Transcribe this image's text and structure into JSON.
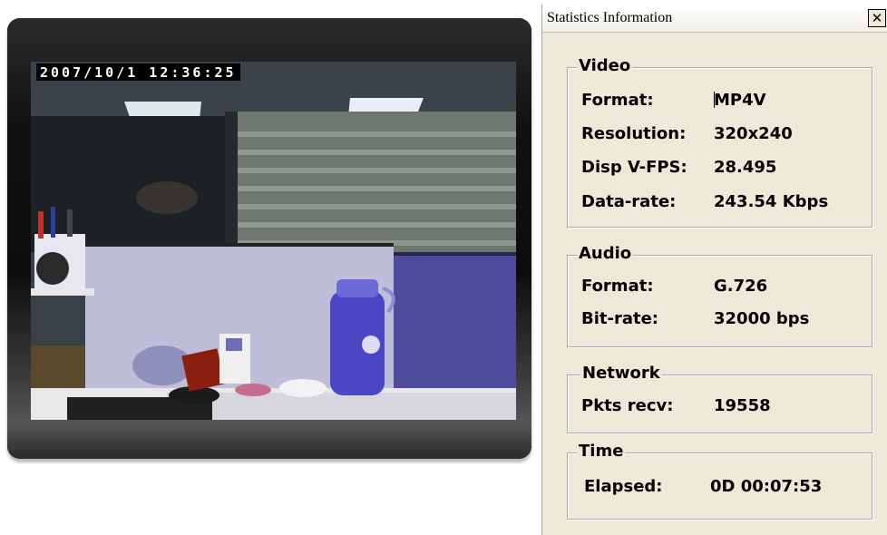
{
  "viewer": {
    "timestamp": "2007/10/1  12:36:25"
  },
  "dialog": {
    "title": "Statistics Information",
    "close_glyph": "✕",
    "video": {
      "legend": "Video",
      "format_label": "Format:",
      "format_value": "MP4V",
      "resolution_label": "Resolution:",
      "resolution_value": "320x240",
      "fps_label": "Disp V-FPS:",
      "fps_value": "28.495",
      "datarate_label": "Data-rate:",
      "datarate_value": "243.54  Kbps"
    },
    "audio": {
      "legend": "Audio",
      "format_label": "Format:",
      "format_value": "G.726",
      "bitrate_label": "Bit-rate:",
      "bitrate_value": "32000 bps"
    },
    "network": {
      "legend": "Network",
      "pkts_label": "Pkts recv:",
      "pkts_value": "19558"
    },
    "time": {
      "legend": "Time",
      "elapsed_label": "Elapsed:",
      "elapsed_value": "0D 00:07:53"
    }
  }
}
